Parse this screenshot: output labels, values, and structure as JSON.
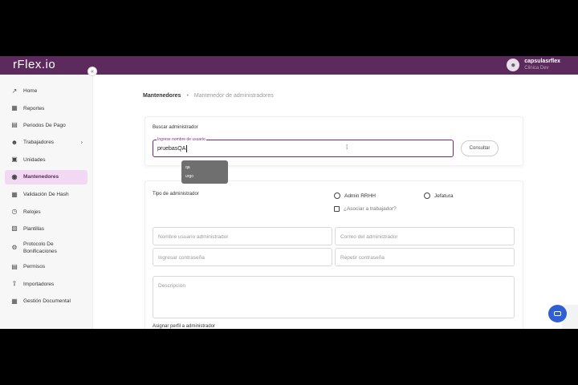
{
  "header": {
    "logo": "rFlex.io",
    "user_name": "capsulasrflex",
    "user_org": "Clinica Dev"
  },
  "sidebar": {
    "items": [
      {
        "label": "Home",
        "icon": "chart-line-icon"
      },
      {
        "label": "Reportes",
        "icon": "report-icon"
      },
      {
        "label": "Periodos De Pago",
        "icon": "calendar-icon"
      },
      {
        "label": "Trabajadores",
        "icon": "users-icon",
        "has_submenu": true
      },
      {
        "label": "Unidades",
        "icon": "building-icon"
      },
      {
        "label": "Mantenedores",
        "icon": "lock-icon",
        "active": true
      },
      {
        "label": "Validación De Hash",
        "icon": "calendar-check-icon"
      },
      {
        "label": "Relojes",
        "icon": "clock-icon"
      },
      {
        "label": "Plantillas",
        "icon": "template-icon"
      },
      {
        "label": "Protocolo De Bonificaciones",
        "icon": "gear-icon"
      },
      {
        "label": "Permisos",
        "icon": "document-icon"
      },
      {
        "label": "Importadores",
        "icon": "upload-icon"
      },
      {
        "label": "Gestión Documental",
        "icon": "folder-icon"
      }
    ]
  },
  "breadcrumb": {
    "first": "Mantenedores",
    "separator": "•",
    "current": "Mantenedor de administradores"
  },
  "search": {
    "title": "Buscar administrador",
    "label": "Ingrese nombre de usuario",
    "value": "pruebasQA",
    "button": "Consultar"
  },
  "dropdown": {
    "options": [
      "qa",
      "urgo"
    ]
  },
  "form": {
    "type_label": "Tipo de administrador",
    "radio_rrhh": "Admin RRHH",
    "radio_jefatura": "Jefatura",
    "checkbox_label": "¿Asociar a trabajador?",
    "username_ph": "Nombre usuario administrador",
    "email_ph": "Correo del administrador",
    "password_ph": "Ingresar contraseña",
    "password_repeat_ph": "Repetir contraseña",
    "description_ph": "Descripción",
    "assign_label": "Asignar perfil a administrador"
  }
}
